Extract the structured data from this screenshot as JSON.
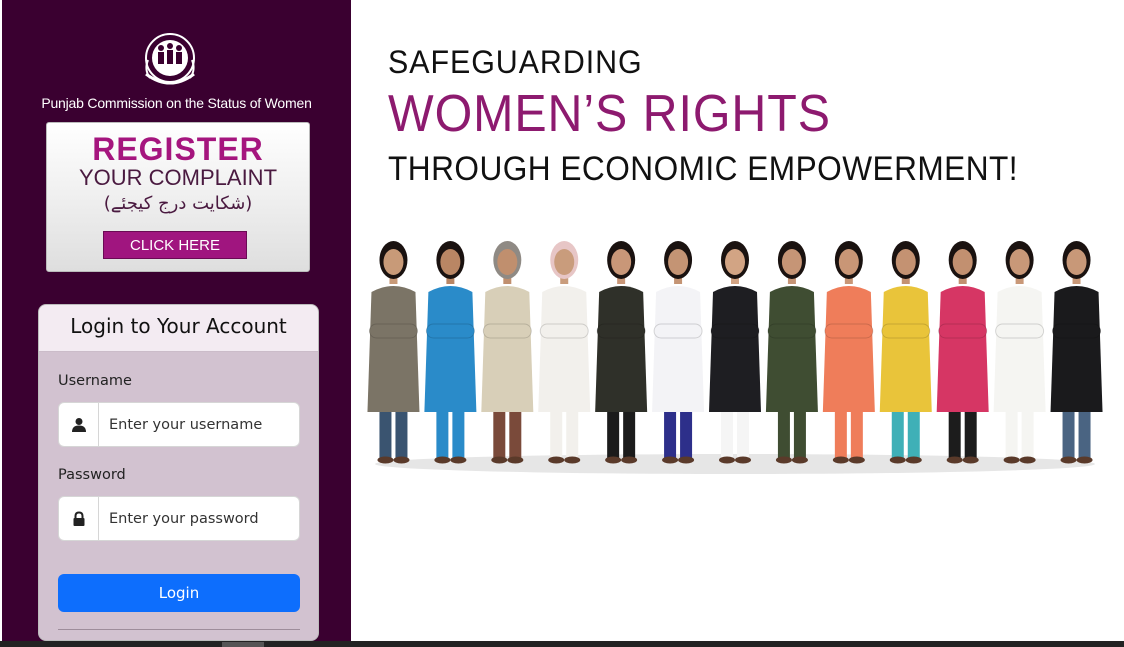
{
  "sidebar": {
    "org_name": "Punjab Commission on the Status of Women",
    "logo_icon": "pcsw-emblem-icon",
    "register": {
      "title": "REGISTER",
      "subtitle": "YOUR COMPLAINT",
      "urdu": "(شکایت درج کیجئے)",
      "button_label": "CLICK HERE"
    }
  },
  "login": {
    "heading": "Login to Your Account",
    "username_label": "Username",
    "username_placeholder": "Enter your username",
    "password_label": "Password",
    "password_placeholder": "Enter your password",
    "button_label": "Login"
  },
  "hero": {
    "line1": "SAFEGUARDING",
    "line2": "WOMEN’S RIGHTS",
    "line3": "THROUGH ECONOMIC EMPOWERMENT!"
  },
  "colors": {
    "sidebar_bg": "#3a0030",
    "accent": "#a0157f",
    "headline_accent": "#8d1a6f",
    "login_button": "#0d6efd",
    "login_card": "#d2c2d0"
  },
  "banner": {
    "people": [
      {
        "top": "#7b7466",
        "bottom": "#3a5470",
        "skin": "#c89a78",
        "hair": "#1a1210"
      },
      {
        "top": "#2a8bc9",
        "bottom": "#2a8bc9",
        "skin": "#b98664",
        "hair": "#1a1210"
      },
      {
        "top": "#d8cfb8",
        "bottom": "#7a4a3a",
        "skin": "#c08f6e",
        "hair": "#8f8a84"
      },
      {
        "top": "#f2f0ec",
        "bottom": "#f2f0ec",
        "skin": "#c99c7c",
        "hair": "#e7c6c6"
      },
      {
        "top": "#2f3029",
        "bottom": "#1b1b1b",
        "skin": "#c99778",
        "hair": "#1a1210"
      },
      {
        "top": "#f3f3f6",
        "bottom": "#2d2f8a",
        "skin": "#c49474",
        "hair": "#1a1210"
      },
      {
        "top": "#1e1e22",
        "bottom": "#f5f5f5",
        "skin": "#d2a484",
        "hair": "#1a1210"
      },
      {
        "top": "#3f4d32",
        "bottom": "#3f4d32",
        "skin": "#c69576",
        "hair": "#1a1210"
      },
      {
        "top": "#ef7d5a",
        "bottom": "#ef7d5a",
        "skin": "#c99676",
        "hair": "#1a1210"
      },
      {
        "top": "#e9c43a",
        "bottom": "#3fb0b7",
        "skin": "#c49272",
        "hair": "#1a1210"
      },
      {
        "top": "#d63664",
        "bottom": "#1c1c1c",
        "skin": "#c29070",
        "hair": "#1a1210"
      },
      {
        "top": "#f5f5f2",
        "bottom": "#f5f5f2",
        "skin": "#c99878",
        "hair": "#1a1210"
      },
      {
        "top": "#1a1a1c",
        "bottom": "#4a6482",
        "skin": "#c89878",
        "hair": "#1a1210"
      }
    ]
  }
}
